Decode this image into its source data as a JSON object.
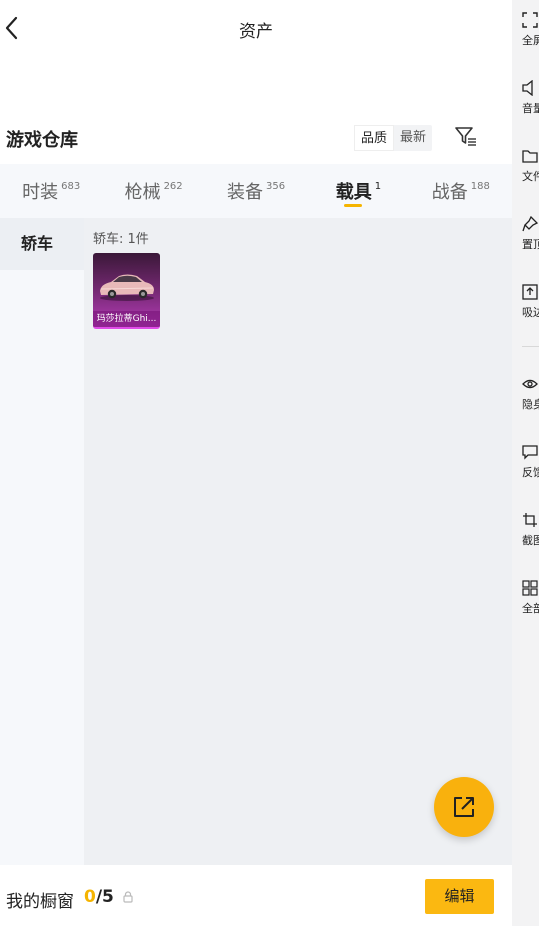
{
  "header": {
    "title": "资产",
    "back_icon": "chevron-left-icon"
  },
  "warehouse": {
    "title": "游戏仓库",
    "sort_options": [
      "品质",
      "最新"
    ],
    "filter_icon": "filter-icon"
  },
  "tabs": [
    {
      "label": "时装",
      "count": "683"
    },
    {
      "label": "枪械",
      "count": "262"
    },
    {
      "label": "装备",
      "count": "356"
    },
    {
      "label": "载具",
      "count": "1"
    },
    {
      "label": "战备",
      "count": "188"
    }
  ],
  "active_tab": "载具",
  "sidebar": {
    "items": [
      {
        "label": "轿车"
      }
    ]
  },
  "content": {
    "group_label": "轿车: 1件",
    "items": [
      {
        "name": "玛莎拉蒂Ghi..."
      }
    ]
  },
  "fab": {
    "icon": "share-external-icon",
    "color": "#f9b10d"
  },
  "showcase": {
    "label": "我的橱窗",
    "current": "0",
    "total": "/5",
    "lock_icon": "lock-icon"
  },
  "edit_button": {
    "label": "编辑",
    "color": "#fbb811"
  },
  "toolbar": {
    "items": [
      {
        "label": "全屏",
        "icon": "fullscreen-icon"
      },
      {
        "label": "音量",
        "icon": "volume-icon"
      },
      {
        "label": "文件",
        "icon": "folder-icon"
      },
      {
        "label": "置顶",
        "icon": "pin-icon"
      },
      {
        "label": "吸边",
        "icon": "dock-icon"
      },
      {
        "label": "隐身",
        "icon": "eye-icon"
      },
      {
        "label": "反馈",
        "icon": "feedback-icon"
      },
      {
        "label": "截图",
        "icon": "screenshot-icon"
      },
      {
        "label": "全部",
        "icon": "grid-icon"
      }
    ]
  },
  "colors": {
    "accent": "#f5b400",
    "tab_bg": "#f6f8fb",
    "content_bg": "#eef0f3"
  }
}
